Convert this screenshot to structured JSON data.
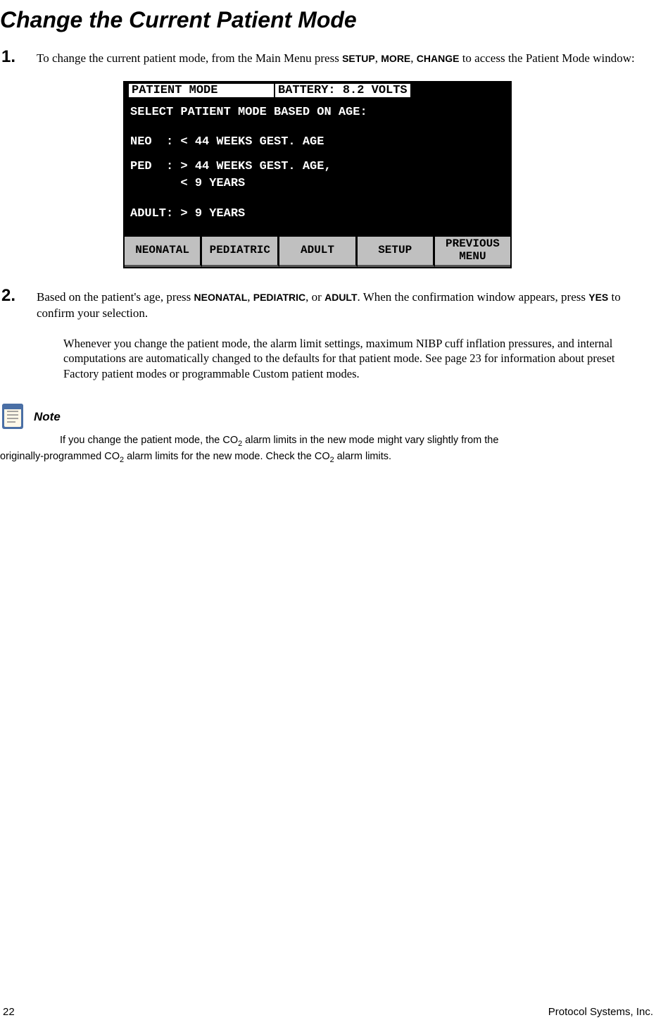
{
  "title": "Change the Current Patient Mode",
  "steps": {
    "s1": {
      "num": "1.",
      "text_pre": "To change the current patient mode, from the Main Menu press ",
      "btn1": "SETUP",
      "sep1": ", ",
      "btn2": "MORE",
      "sep2": ", ",
      "btn3": "CHANGE",
      "text_post": " to access the Patient Mode window:"
    },
    "s2": {
      "num": "2.",
      "text_pre": "Based on the patient's age, press ",
      "btn1": "NEONATAL",
      "sep1": ", ",
      "btn2": "PEDIATRIC",
      "sep2": ", or ",
      "btn3": "ADULT",
      "text_mid": ". When the confirmation window appears, press ",
      "btn4": "YES",
      "text_post": " to confirm your selection."
    }
  },
  "screen": {
    "header_left": "PATIENT MODE",
    "header_right": "BATTERY: 8.2 VOLTS",
    "line1": "SELECT PATIENT MODE BASED ON AGE:",
    "line2": "NEO  : < 44 WEEKS GEST. AGE",
    "line3": "PED  : > 44 WEEKS GEST. AGE,",
    "line4": "       < 9 YEARS",
    "line5": "ADULT: > 9 YEARS",
    "buttons": {
      "b1": "NEONATAL",
      "b2": "PEDIATRIC",
      "b3": "ADULT",
      "b4": "SETUP",
      "b5": "PREVIOUS\nMENU"
    }
  },
  "sub_para": "Whenever you change the patient mode, the alarm limit settings, maximum NIBP cuff inflation pressures, and internal computations are automatically changed to the defaults for that patient mode. See page 23 for information about preset Factory patient modes or programmable Custom patient modes.",
  "note": {
    "label": "Note",
    "text_line1_pre": "If you change the patient mode, the CO",
    "sub": "2",
    "text_line1_post": " alarm limits in the new mode might vary slightly from the",
    "text_line2_pre": "originally-programmed CO",
    "text_line2_mid": " alarm limits for the new mode. Check the CO",
    "text_line2_post": " alarm limits."
  },
  "footer": {
    "page": "22",
    "company": "Protocol Systems, Inc."
  }
}
